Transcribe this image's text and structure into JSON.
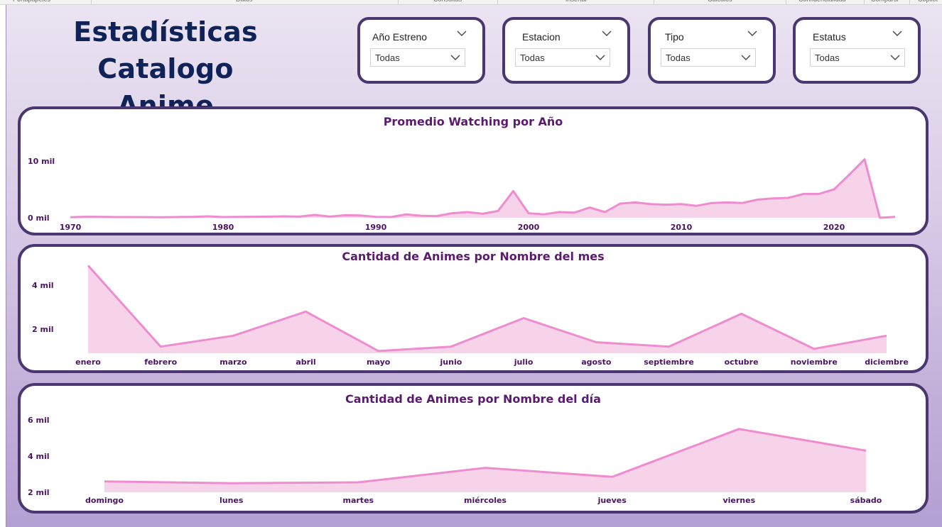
{
  "ribbon": [
    "Portapapeles",
    "Datos",
    "Consultas",
    "Insertar",
    "Cálculos",
    "Confidencialidad",
    "Compartir",
    "Copilot"
  ],
  "title_line1": "Estadísticas",
  "title_line2": "Catalogo Anime",
  "slicers": [
    {
      "header": "Año Estreno",
      "value": "Todas"
    },
    {
      "header": "Estacion",
      "value": "Todas"
    },
    {
      "header": "Tipo",
      "value": "Todas"
    },
    {
      "header": "Estatus",
      "value": "Todas"
    }
  ],
  "icons": {
    "dropdown": "chevron-down-icon"
  },
  "colors": {
    "line": "#ee8ccf",
    "fill": "#f7d3ea",
    "border": "#4a3670",
    "title_text": "#0f2358",
    "chart_title": "#5a1b6e"
  },
  "chart_data": [
    {
      "type": "area",
      "title": "Promedio Watching por Año",
      "x": [
        1970,
        1971,
        1972,
        1973,
        1974,
        1975,
        1976,
        1977,
        1978,
        1979,
        1980,
        1981,
        1982,
        1983,
        1984,
        1985,
        1986,
        1987,
        1988,
        1989,
        1990,
        1991,
        1992,
        1993,
        1994,
        1995,
        1996,
        1997,
        1998,
        1999,
        2000,
        2001,
        2002,
        2003,
        2004,
        2005,
        2006,
        2007,
        2008,
        2009,
        2010,
        2011,
        2012,
        2013,
        2014,
        2015,
        2016,
        2017,
        2018,
        2019,
        2020,
        2021,
        2022,
        2023,
        2024
      ],
      "values": [
        100,
        180,
        150,
        120,
        130,
        110,
        100,
        120,
        160,
        250,
        120,
        150,
        180,
        200,
        250,
        200,
        500,
        200,
        450,
        400,
        150,
        120,
        600,
        350,
        300,
        800,
        1000,
        700,
        1200,
        4700,
        800,
        600,
        1000,
        900,
        1800,
        1000,
        2500,
        2700,
        2400,
        2300,
        2400,
        2100,
        2600,
        2700,
        2600,
        3200,
        3400,
        3500,
        4200,
        4200,
        5000,
        7600,
        10300,
        0,
        150
      ],
      "xticks": [
        "1970",
        "1980",
        "1990",
        "2000",
        "2010",
        "2020"
      ],
      "xtick_values": [
        1970,
        1980,
        1990,
        2000,
        2010,
        2020
      ],
      "yticks": [
        "0 mil",
        "10 mil"
      ],
      "ytick_values": [
        0,
        10000
      ],
      "ylim": [
        0,
        11000
      ]
    },
    {
      "type": "area",
      "title": "Cantidad de Animes por Nombre del mes",
      "categories": [
        "enero",
        "febrero",
        "marzo",
        "abril",
        "mayo",
        "junio",
        "julio",
        "agosto",
        "septiembre",
        "octubre",
        "noviembre",
        "diciembre"
      ],
      "values": [
        4900,
        1200,
        1700,
        2800,
        1000,
        1200,
        2500,
        1400,
        1200,
        2700,
        1100,
        1700
      ],
      "yticks": [
        "2 mil",
        "4 mil"
      ],
      "ytick_values": [
        2000,
        4000
      ],
      "ylim": [
        900,
        5300
      ]
    },
    {
      "type": "area",
      "title": "Cantidad de Animes por Nombre del día",
      "categories": [
        "domingo",
        "lunes",
        "martes",
        "miércoles",
        "jueves",
        "viernes",
        "sábado"
      ],
      "values": [
        2600,
        2500,
        2550,
        3350,
        2850,
        5500,
        4300
      ],
      "yticks": [
        "2 mil",
        "4 mil",
        "6 mil"
      ],
      "ytick_values": [
        2000,
        4000,
        6000
      ],
      "ylim": [
        2000,
        6000
      ]
    }
  ]
}
